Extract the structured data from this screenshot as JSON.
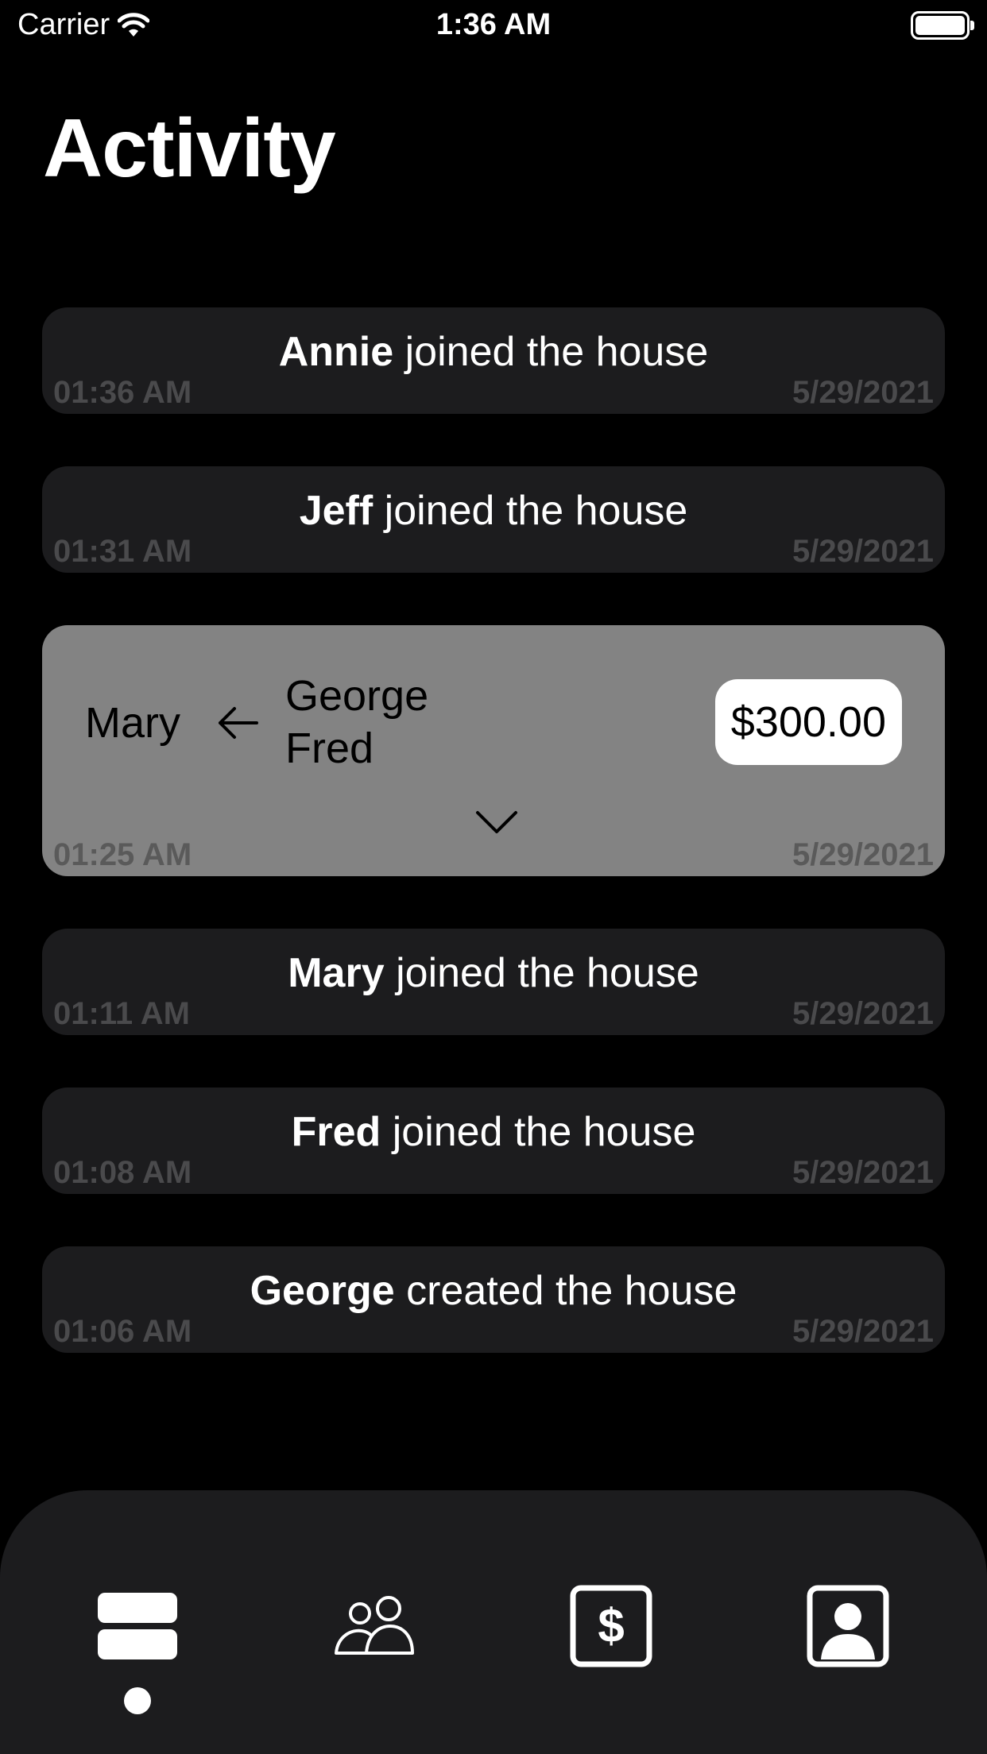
{
  "status_bar": {
    "carrier": "Carrier",
    "time": "1:36 AM"
  },
  "title": "Activity",
  "activities": [
    {
      "name": "Annie",
      "action": "joined the house",
      "time": "01:36 AM",
      "date": "5/29/2021"
    },
    {
      "name": "Jeff",
      "action": "joined the house",
      "time": "01:31 AM",
      "date": "5/29/2021"
    },
    {
      "payee": "Mary",
      "payers": [
        "George",
        "Fred"
      ],
      "amount": "$300.00",
      "time": "01:25 AM",
      "date": "5/29/2021"
    },
    {
      "name": "Mary",
      "action": "joined the house",
      "time": "01:11 AM",
      "date": "5/29/2021"
    },
    {
      "name": "Fred",
      "action": "joined the house",
      "time": "01:08 AM",
      "date": "5/29/2021"
    },
    {
      "name": "George",
      "action": "created the house",
      "time": "01:06 AM",
      "date": "5/29/2021"
    }
  ],
  "tabbar": {
    "tabs": [
      {
        "icon": "activity-feed-icon",
        "active": true
      },
      {
        "icon": "people-icon",
        "active": false
      },
      {
        "icon": "dollar-icon",
        "active": false
      },
      {
        "icon": "profile-icon",
        "active": false
      }
    ]
  }
}
